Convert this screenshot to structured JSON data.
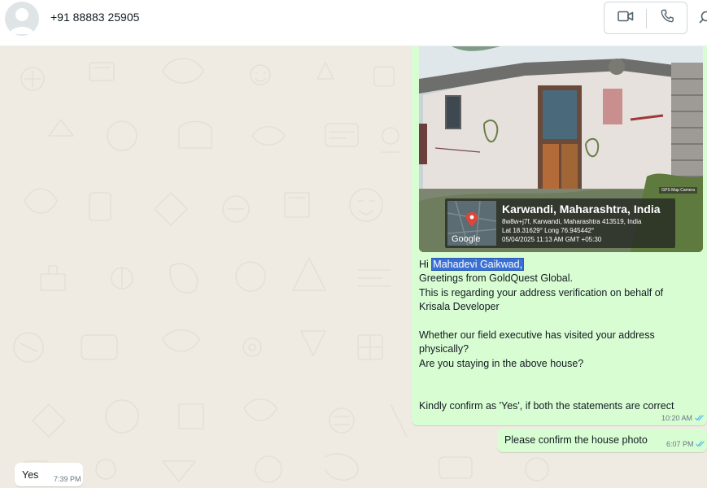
{
  "header": {
    "contact_name": "+91 88883 25905",
    "icons": [
      "avatar-icon",
      "video-call-icon",
      "voice-call-icon",
      "search-icon"
    ]
  },
  "messages": {
    "photo": {
      "location_title": "Karwandi, Maharashtra, India",
      "address_line": "8w8w+j7f, Karwandi, Maharashtra 413519, India",
      "coords_line": "Lat 18.31629° Long 76.945442°",
      "datetime_line": "05/04/2025 11:13 AM GMT +05:30",
      "map_label": "Google",
      "camera_badge": "GPS Map Camera"
    },
    "main": {
      "greeting_prefix": "Hi ",
      "greeting_name": "Mahadevi Gaikwad,",
      "line2": "Greetings from GoldQuest Global.",
      "line3": "This is regarding your address verification on behalf of",
      "line4": "Krisala Developer",
      "line5": "Whether our field executive has visited your address",
      "line6": "physically?",
      "line7": "Are you staying in the above house?",
      "line8": "Kindly confirm as 'Yes', if both the statements are correct",
      "time": "10:20 AM"
    },
    "followup": {
      "text": "Please confirm the house photo",
      "time": "6:07 PM"
    },
    "reply": {
      "text": "Yes",
      "time": "7:39 PM"
    }
  },
  "colors": {
    "outgoing_bubble": "#d9fdd3",
    "incoming_bubble": "#ffffff",
    "chat_background": "#efeae2",
    "read_ticks": "#53bdeb",
    "selection_highlight": "#3a70d4"
  }
}
